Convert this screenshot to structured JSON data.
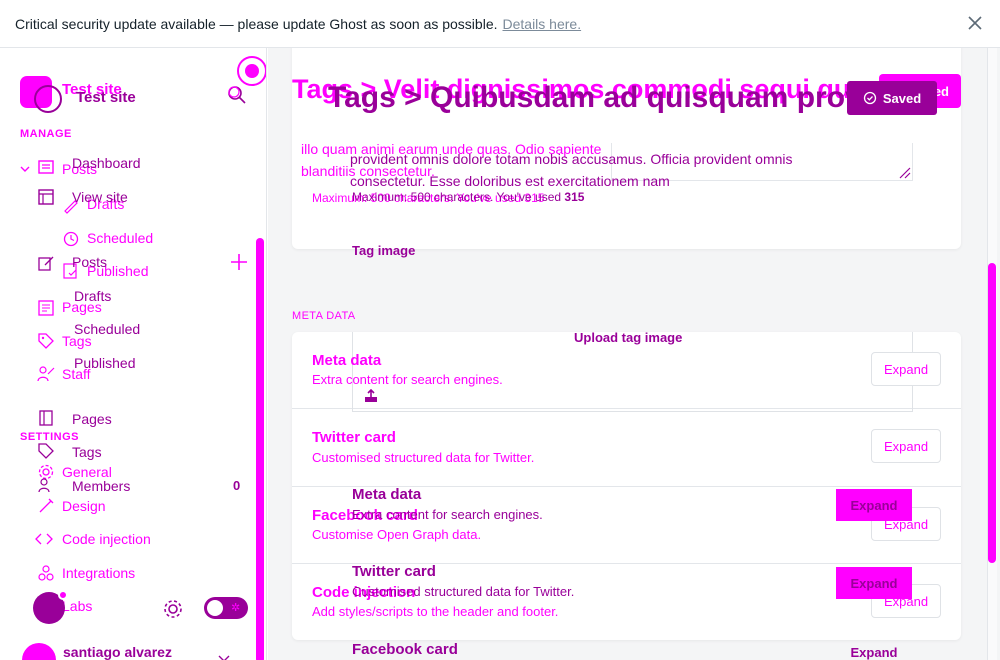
{
  "banner": {
    "message": "Critical security update available — please update Ghost as soon as possible.",
    "link": "Details here."
  },
  "sidebar": {
    "site_name_primary": "Test site",
    "site_name_secondary": "Test site",
    "manage_title": "MANAGE",
    "settings_title": "SETTINGS",
    "nav_a": {
      "posts": "Posts",
      "drafts": "Drafts",
      "scheduled": "Scheduled",
      "published": "Published",
      "pages": "Pages",
      "tags": "Tags",
      "staff": "Staff",
      "general": "General",
      "design": "Design",
      "code_injection": "Code injection",
      "integrations": "Integrations",
      "labs": "Labs"
    },
    "nav_b": {
      "dashboard": "Dashboard",
      "view_site": "View site",
      "posts": "Posts",
      "drafts": "Drafts",
      "scheduled": "Scheduled",
      "published": "Published",
      "pages": "Pages",
      "tags": "Tags",
      "members": "Members",
      "members_count": "0"
    },
    "user_name": "santiago alvarez"
  },
  "header": {
    "title_primary": "Tags > Velit dignissimos commodi sequi qu",
    "title_secondary": "Tags > Quibusdam ad quisquam prov",
    "saved_primary": "Saved",
    "saved_secondary": "Saved"
  },
  "description": {
    "text_primary": "illo quam animi earum unde quas. Odio sapiente blanditiis consectetur.",
    "text_secondary": "provident omnis dolore totam nobis accusamus. Officia provident omnis consectetur. Esse doloribus est exercitationem nam",
    "hint_primary": "Maximum: 500 characters. You've used 315",
    "hint_secondary_prefix": "Maximum: 500 characters. You've used ",
    "hint_secondary_count": "315"
  },
  "tag_image": {
    "label": "Tag image",
    "upload_label": "Upload tag image"
  },
  "meta_section": {
    "title": "META DATA",
    "rows_a": [
      {
        "title": "Meta data",
        "subtitle": "Extra content for search engines.",
        "button": "Expand"
      },
      {
        "title": "Twitter card",
        "subtitle": "Customised structured data for Twitter.",
        "button": "Expand"
      },
      {
        "title": "Facebook card",
        "subtitle": "Customise Open Graph data.",
        "button": "Expand"
      },
      {
        "title": "Code injection",
        "subtitle": "Add styles/scripts to the header and footer.",
        "button": "Expand"
      }
    ],
    "rows_b": [
      {
        "title": "Meta data",
        "subtitle": "Extra content for search engines.",
        "button": "Expand"
      },
      {
        "title": "Twitter card",
        "subtitle": "Customised structured data for Twitter.",
        "button": "Expand"
      },
      {
        "title": "Facebook card",
        "subtitle": "",
        "button": "Expand"
      }
    ]
  },
  "colors": {
    "accent_bright": "#ff00ff",
    "accent_dark": "#990099",
    "background": "#f4f5f6"
  }
}
